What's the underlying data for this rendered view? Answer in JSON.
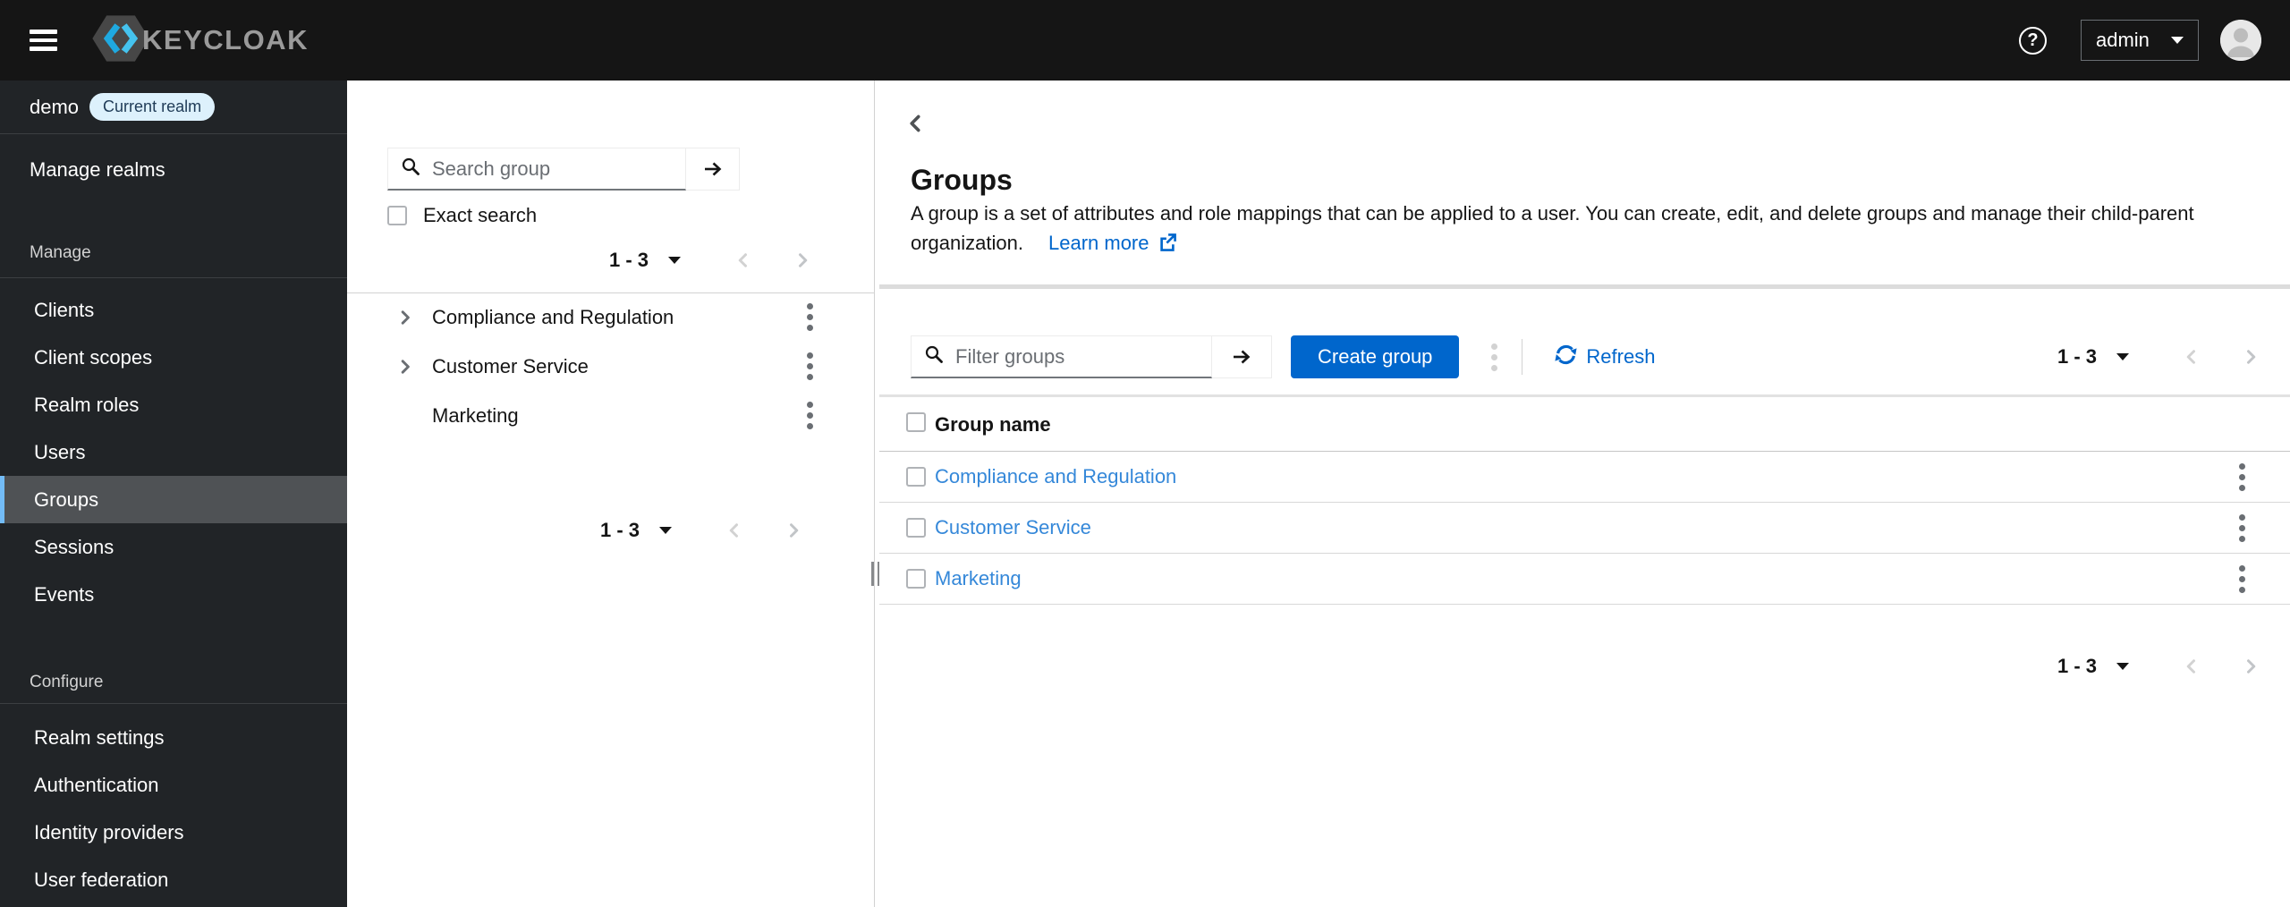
{
  "masthead": {
    "brand": "KEYCLOAK",
    "user": "admin"
  },
  "sidebar": {
    "realm": {
      "name": "demo",
      "badge": "Current realm"
    },
    "top_item": "Manage realms",
    "sections": [
      {
        "label": "Manage",
        "selected": "Groups",
        "items": [
          "Clients",
          "Client scopes",
          "Realm roles",
          "Users",
          "Groups",
          "Sessions",
          "Events"
        ]
      },
      {
        "label": "Configure",
        "selected": "",
        "items": [
          "Realm settings",
          "Authentication",
          "Identity providers",
          "User federation"
        ]
      }
    ]
  },
  "tree_panel": {
    "search_placeholder": "Search group",
    "exact_search_label": "Exact search",
    "pagination": "1 - 3",
    "groups": [
      {
        "name": "Compliance and Regulation",
        "expandable": true
      },
      {
        "name": "Customer Service",
        "expandable": true
      },
      {
        "name": "Marketing",
        "expandable": false
      }
    ]
  },
  "main": {
    "title": "Groups",
    "description": "A group is a set of attributes and role mappings that can be applied to a user. You can create, edit, and delete groups and manage their child-parent organization.",
    "learn_more": "Learn more",
    "toolbar": {
      "filter_placeholder": "Filter groups",
      "create_button": "Create group",
      "refresh_label": "Refresh",
      "pagination": "1 - 3"
    },
    "table": {
      "header": "Group name",
      "rows": [
        "Compliance and Regulation",
        "Customer Service",
        "Marketing"
      ]
    },
    "footer_pagination": "1 - 3"
  },
  "colors": {
    "masthead_bg": "#151515",
    "sidebar_bg": "#212427",
    "nav_selected_bg": "#4f5255",
    "nav_highlight": "#73bcf7",
    "primary": "#0066cc",
    "table_link": "#3588d9",
    "badge_bg": "#ddf1fc",
    "divider": "#d2d2d2"
  }
}
